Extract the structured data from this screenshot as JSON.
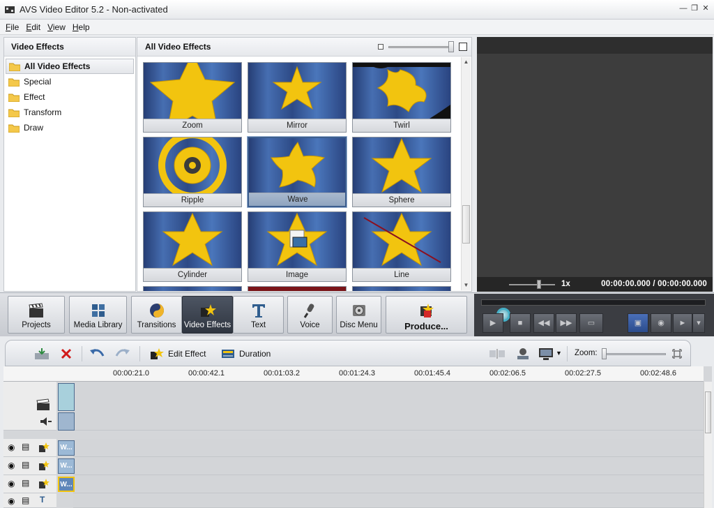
{
  "window": {
    "title": "AVS Video Editor 5.2 - Non-activated"
  },
  "menu": [
    "File",
    "Edit",
    "View",
    "Help"
  ],
  "left_panel": {
    "header": "Video Effects",
    "categories": [
      {
        "label": "All Video Effects",
        "selected": true
      },
      {
        "label": "Special"
      },
      {
        "label": "Effect"
      },
      {
        "label": "Transform"
      },
      {
        "label": "Draw"
      }
    ]
  },
  "effects_panel": {
    "header": "All Video Effects",
    "effects": [
      {
        "label": "Zoom"
      },
      {
        "label": "Mirror"
      },
      {
        "label": "Twirl"
      },
      {
        "label": "Ripple"
      },
      {
        "label": "Wave",
        "selected": true
      },
      {
        "label": "Sphere"
      },
      {
        "label": "Cylinder"
      },
      {
        "label": "Image"
      },
      {
        "label": "Line"
      }
    ]
  },
  "preview": {
    "speed": "1x",
    "time": "00:00:00.000 / 00:00:00.000"
  },
  "toolbar": {
    "buttons": [
      {
        "label": "Projects",
        "icon": "clapperboard-icon"
      },
      {
        "label": "Media Library",
        "icon": "film-grid-icon"
      },
      {
        "label": "Transitions",
        "icon": "swirl-icon"
      },
      {
        "label": "Video Effects",
        "icon": "effects-star-icon",
        "active": true
      },
      {
        "label": "Text",
        "icon": "text-t-icon"
      },
      {
        "label": "Voice",
        "icon": "microphone-icon"
      },
      {
        "label": "Disc Menu",
        "icon": "disc-icon"
      },
      {
        "label": "Produce...",
        "icon": "produce-icon"
      }
    ]
  },
  "timeline_toolbar": {
    "edit_effect": "Edit Effect",
    "duration": "Duration",
    "zoom_label": "Zoom:"
  },
  "timeline": {
    "ruler_ticks": [
      "00:00:21.0",
      "00:00:42.1",
      "00:01:03.2",
      "00:01:24.3",
      "00:01:45.4",
      "00:02:06.5",
      "00:02:27.5",
      "00:02:48.6"
    ],
    "clip_label": "W..."
  },
  "colors": {
    "active_button": "#2f3540",
    "effect_tile_bg": "#3d5f9b",
    "star_yellow": "#f2c40f",
    "preview_bg": "#3d3d3d",
    "player_knob": "#45b0c8"
  }
}
